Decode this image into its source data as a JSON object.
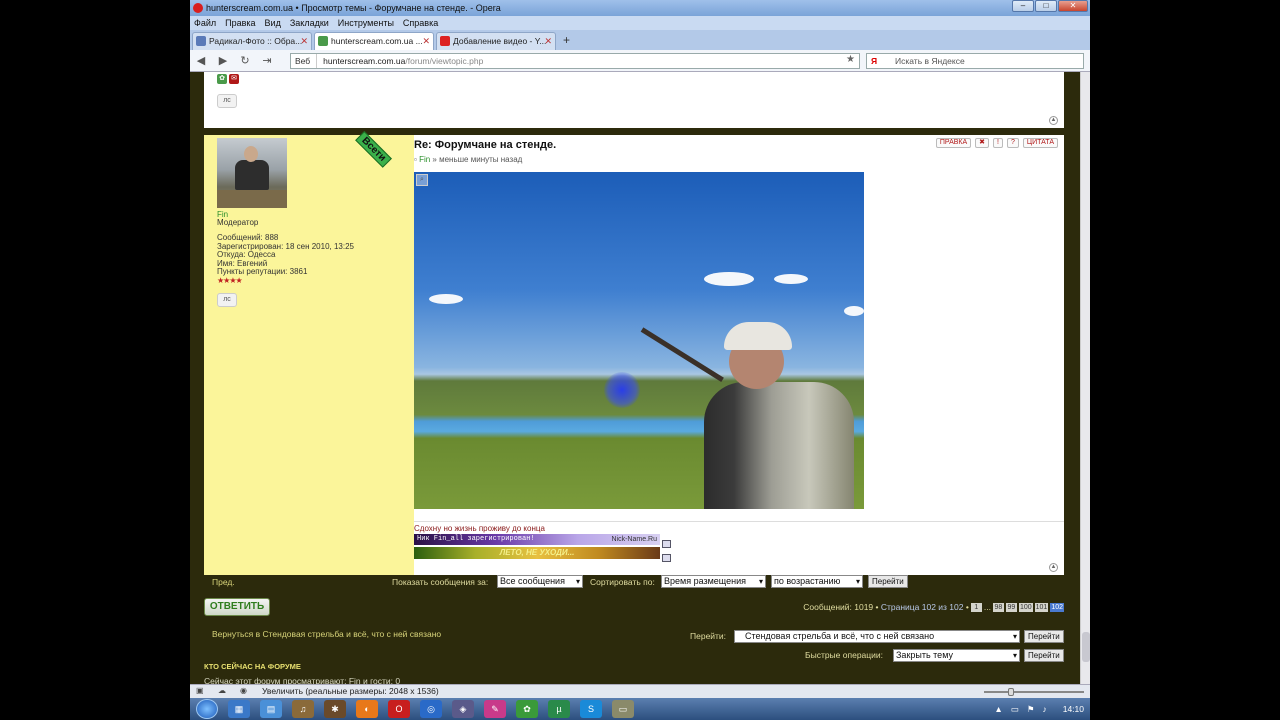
{
  "window": {
    "title": "hunterscream.com.ua • Просмотр темы - Форумчане на стенде. - Opera",
    "buttons": {
      "minimize": "–",
      "maximize": "□",
      "close": "✕"
    }
  },
  "menu": [
    "Файл",
    "Правка",
    "Вид",
    "Закладки",
    "Инструменты",
    "Справка"
  ],
  "tabs": [
    {
      "label": "Радикал-Фото :: Обра...",
      "active": false,
      "fav_color": "#5a7ab8"
    },
    {
      "label": "hunterscream.com.ua ...",
      "active": true,
      "fav_color": "#4a9a4a"
    },
    {
      "label": "Добавление видео - Y...",
      "active": false,
      "fav_color": "#d22"
    }
  ],
  "address": {
    "web_label": "Веб",
    "url_host": "hunterscream.com.ua",
    "url_path": "/forum/viewtopic.php",
    "search_placeholder": "Искать в Яндексе",
    "search_engine": "Я"
  },
  "post": {
    "title": "Re: Форумчане на стенде.",
    "author": "Fin",
    "time": "меньше минуты назад",
    "buttons": {
      "edit": "ПРАВКА",
      "quote": "ЦИТАТА"
    },
    "badge": "Всети",
    "profile": {
      "name": "Fin",
      "role": "Модератор",
      "messages": "Сообщений: 888",
      "registered": "Зарегистрирован: 18 сен 2010, 13:25",
      "from": "Откуда: Одесса",
      "realname": "Имя: Евгений",
      "reputation": "Пункты репутации: 3861",
      "stars": "★★★★",
      "pm_label": "лс"
    },
    "signature": {
      "text": "Сдохну но жизнь проживу до конца",
      "banner1": "Ник Fin_all зарегистрирован!",
      "banner1_site": "Nick-Name.Ru",
      "banner2": "ЛЕТО, НЕ УХОДИ..."
    }
  },
  "controls": {
    "prev": "Пред.",
    "show_label": "Показать сообщения за:",
    "show_value": "Все сообщения",
    "sort_label": "Сортировать по:",
    "sort_value": "Время размещения",
    "order_value": "по возрастанию",
    "go": "Перейти"
  },
  "reply": {
    "button": "ОТВЕТИТЬ",
    "messages": "Сообщений: 1019 •",
    "page": "Страница 102 из 102",
    "pages": [
      "1",
      "...",
      "98",
      "99",
      "100",
      "101",
      "102"
    ],
    "current_page": "102"
  },
  "footer": {
    "back": "Вернуться в Стендовая стрельба и всё, что с ней связано",
    "goto_label": "Перейти:",
    "goto_value": "Стендовая стрельба и всё, что с ней связано",
    "go": "Перейти",
    "quick_label": "Быстрые операции:",
    "quick_value": "Закрыть тему",
    "who_title": "КТО СЕЙЧАС НА ФОРУМЕ",
    "who_text": "Сейчас этот форум просматривают: Fin и гости: 0"
  },
  "status": {
    "text": "Увеличить (реальные размеры: 2048 x 1536)"
  },
  "tray": {
    "time": "14:10"
  }
}
